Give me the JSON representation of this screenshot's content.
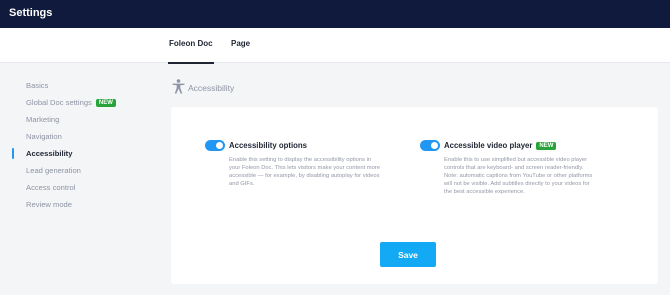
{
  "header": {
    "title": "Settings"
  },
  "tabs": [
    {
      "label": "Foleon Doc",
      "active": true
    },
    {
      "label": "Page",
      "active": false
    }
  ],
  "sidebar": {
    "items": [
      {
        "label": "Basics"
      },
      {
        "label": "Global Doc settings",
        "badge": "NEW"
      },
      {
        "label": "Marketing"
      },
      {
        "label": "Navigation"
      },
      {
        "label": "Accessibility",
        "active": true
      },
      {
        "label": "Lead generation"
      },
      {
        "label": "Access control"
      },
      {
        "label": "Review mode"
      }
    ]
  },
  "section": {
    "title": "Accessibility",
    "icon": "accessibility-icon"
  },
  "options": [
    {
      "title": "Accessibility options",
      "enabled": true,
      "description_lines": [
        "Enable this setting to display the accessibility options in",
        "your Foleon Doc. This lets visitors make your content more",
        "accessible — for example, by disabling autoplay for videos",
        "and GIFs."
      ]
    },
    {
      "title": "Accessible video player",
      "badge": "NEW",
      "enabled": true,
      "description_lines": [
        "Enable this to use simplified but accessible video player",
        "controls that are keyboard- and screen reader-friendly.",
        "Note: automatic captions from YouTube or other platforms",
        "will not be visible. Add subtitles directly to your videos for",
        "the best accessible experience."
      ]
    }
  ],
  "save_label": "Save",
  "colors": {
    "header_bg": "#0f1a3c",
    "accent": "#2196f3",
    "save_button": "#14a9f5",
    "badge_green": "#27a33a"
  }
}
